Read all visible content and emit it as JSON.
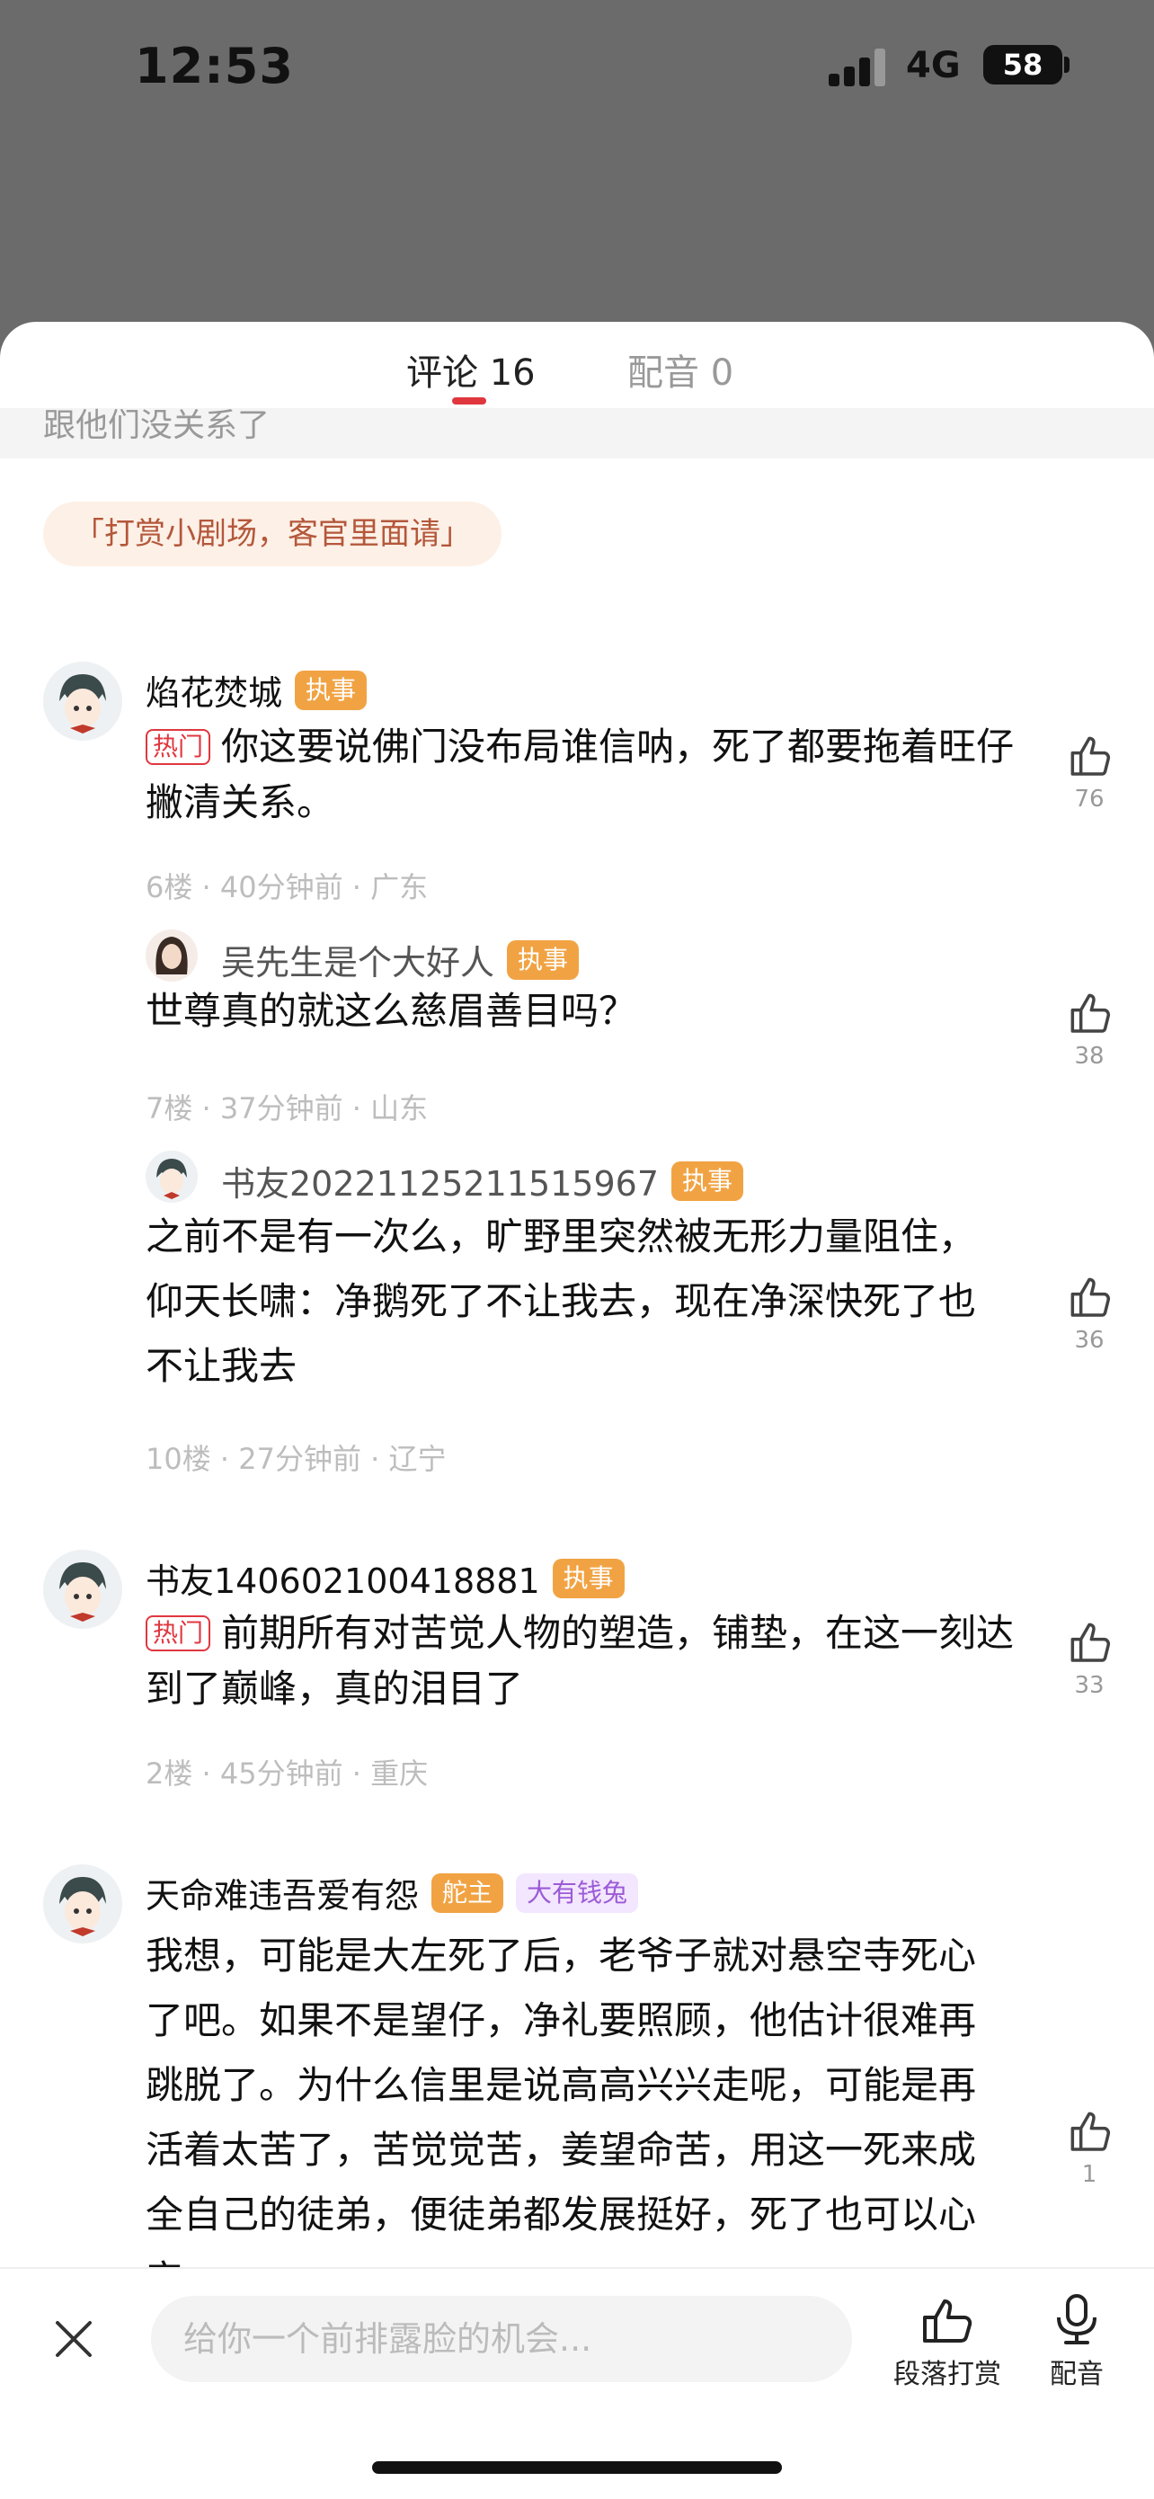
{
  "status": {
    "time": "12:53",
    "network": "4G",
    "battery": "58"
  },
  "tabs": [
    {
      "label": "评论 16"
    },
    {
      "label": "配音 0"
    }
  ],
  "peek_text": "跟他们没关系了",
  "banner": "「打赏小剧场，客官里面请」",
  "threads": [
    {
      "name": "焰花焚城",
      "badges": [
        "执事"
      ],
      "hot_label": "热门",
      "text": "你这要说佛门没布局谁信呐，死了都要拖着旺仔撇清关系。",
      "meta": "6楼 · 40分钟前 · 广东",
      "likes": "76",
      "replies": [
        {
          "name": "吴先生是个大好人",
          "badge": "执事",
          "text": "世尊真的就这么慈眉善目吗？",
          "meta": "7楼 · 37分钟前 · 山东",
          "likes": "38"
        },
        {
          "name": "书友20221125211515967",
          "badge": "执事",
          "text": "之前不是有一次么，旷野里突然被无形力量阻住，仰天长啸：净鹅死了不让我去，现在净深快死了也不让我去",
          "meta": "10楼 · 27分钟前 · 辽宁",
          "likes": "36"
        }
      ]
    },
    {
      "name": "书友140602100418881",
      "badges": [
        "执事"
      ],
      "hot_label": "热门",
      "text": "前期所有对苦觉人物的塑造，铺垫，在这一刻达到了巅峰，真的泪目了",
      "meta": "2楼 · 45分钟前 · 重庆",
      "likes": "33"
    },
    {
      "name": "天命难违吾爱有怨",
      "badges": [
        "舵主",
        "大有钱兔"
      ],
      "text": "我想，可能是大左死了后，老爷子就对悬空寺死心了吧。如果不是望仔，净礼要照顾，他估计很难再跳脱了。为什么信里是说高高兴兴走呢，可能是再活着太苦了，苦觉觉苦，姜望命苦，用这一死来成全自己的徒弟，便徒弟都发展挺好，死了也可以心安。",
      "likes": "1"
    }
  ],
  "bottom": {
    "input_placeholder": "给你一个前排露脸的机会...",
    "reward_label": "段落打赏",
    "dub_label": "配音"
  },
  "colors": {
    "accent": "#e0373f",
    "badge": "#f1a343"
  }
}
